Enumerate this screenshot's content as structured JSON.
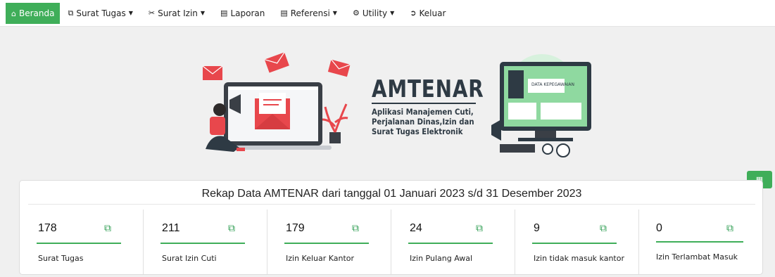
{
  "nav": {
    "items": [
      {
        "label": "Beranda",
        "icon": "home-icon",
        "caret": false,
        "active": true
      },
      {
        "label": "Surat Tugas",
        "icon": "copy-icon",
        "caret": true,
        "active": false
      },
      {
        "label": "Surat Izin",
        "icon": "scissors-icon",
        "caret": true,
        "active": false
      },
      {
        "label": "Laporan",
        "icon": "list-icon",
        "caret": false,
        "active": false
      },
      {
        "label": "Referensi",
        "icon": "list-icon",
        "caret": true,
        "active": false
      },
      {
        "label": "Utility",
        "icon": "gear-icon",
        "caret": true,
        "active": false
      },
      {
        "label": "Keluar",
        "icon": "logout-icon",
        "caret": false,
        "active": false
      }
    ]
  },
  "hero": {
    "title": "AMTENAR",
    "subtitle": "Aplikasi Manajemen Cuti,\nPerjalanan Dinas,Izin dan\nSurat Tugas Elektronik",
    "screen_label": "DATA KEPEGAWAIAN"
  },
  "rekap": {
    "title": "Rekap Data AMTENAR dari tanggal 01 Januari 2023 s/d 31 Desember 2023",
    "stats": [
      {
        "value": "178",
        "label": "Surat Tugas"
      },
      {
        "value": "211",
        "label": "Surat Izin Cuti"
      },
      {
        "value": "179",
        "label": "Izin Keluar Kantor"
      },
      {
        "value": "24",
        "label": "Izin Pulang Awal"
      },
      {
        "value": "9",
        "label": "Izin tidak masuk kantor"
      },
      {
        "value": "0",
        "label": "Izin Terlambat Masuk"
      }
    ]
  },
  "colors": {
    "accent": "#3fae59",
    "dark_text": "#2e3a44",
    "envelope_red": "#e8474c"
  }
}
